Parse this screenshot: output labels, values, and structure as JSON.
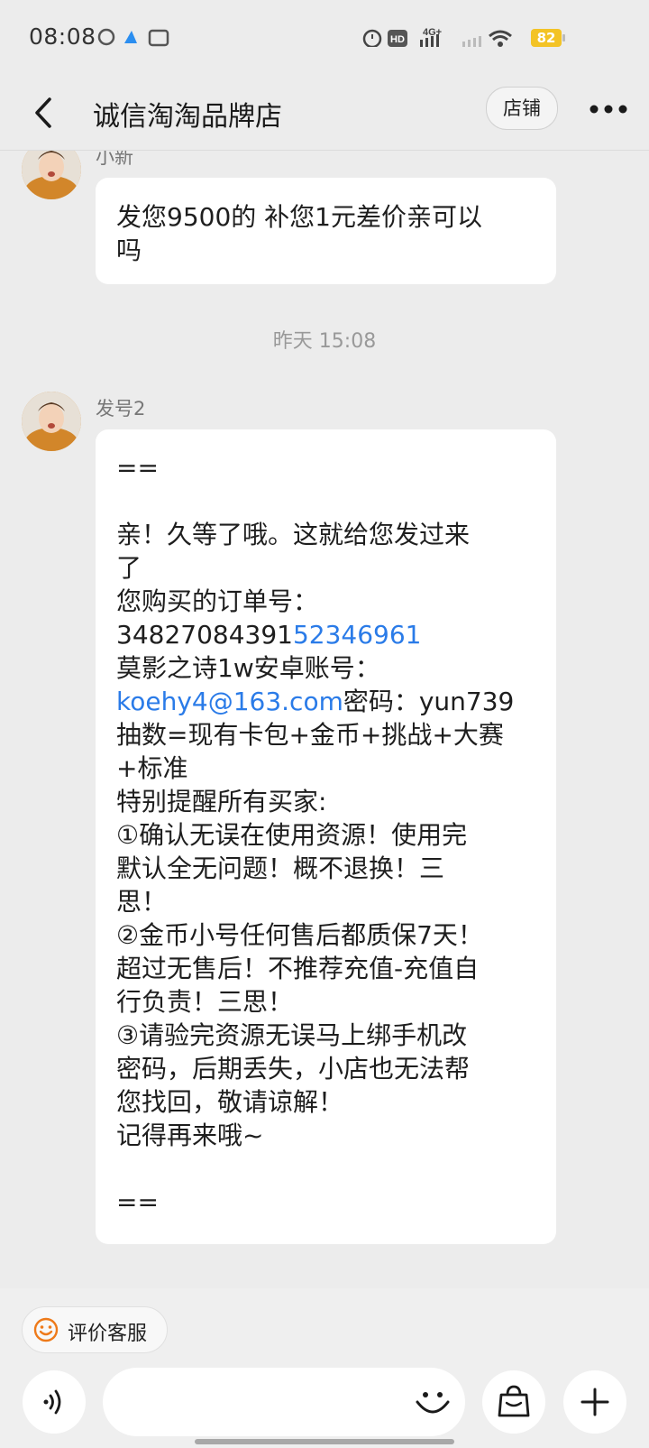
{
  "status": {
    "time": "08:08",
    "battery": "82",
    "network": "4G+",
    "hd": "HD"
  },
  "nav": {
    "title": "诚信淘淘品牌店",
    "shop_button": "店铺"
  },
  "messages": [
    {
      "sender": "小新",
      "lines": [
        "发您9500的 补您1元差价亲可以",
        "吗"
      ]
    },
    {
      "sender": "发号2",
      "order_prefix": "34827084391",
      "order_link": "52346961",
      "email_link": "koehy4@163.com",
      "password_text": "密码：yun739",
      "lines_before": [
        "==",
        "",
        "亲！久等了哦。这就给您发过来",
        "了",
        "您购买的订单号："
      ],
      "lines_after": [
        "莫影之诗1w安卓账号：",
        "抽数=现有卡包+金币+挑战+大赛",
        "+标准",
        "特别提醒所有买家:",
        "①确认无误在使用资源！使用完",
        "默认全无问题！概不退换！三",
        "思！",
        "②金币小号任何售后都质保7天！",
        "超过无售后！不推荐充值-充值自",
        "行负责！三思！",
        "③请验完资源无误马上绑手机改",
        "密码，后期丢失，小店也无法帮",
        "您找回，敬请谅解！",
        "记得再来哦~",
        "",
        "=="
      ]
    }
  ],
  "timestamp": "昨天  15:08",
  "bottom": {
    "rate_label": "评价客服"
  },
  "icons": [
    "back-arrow-icon",
    "more-dots-icon",
    "voice-icon",
    "emoji-icon",
    "bag-icon",
    "plus-icon",
    "smile-icon"
  ]
}
